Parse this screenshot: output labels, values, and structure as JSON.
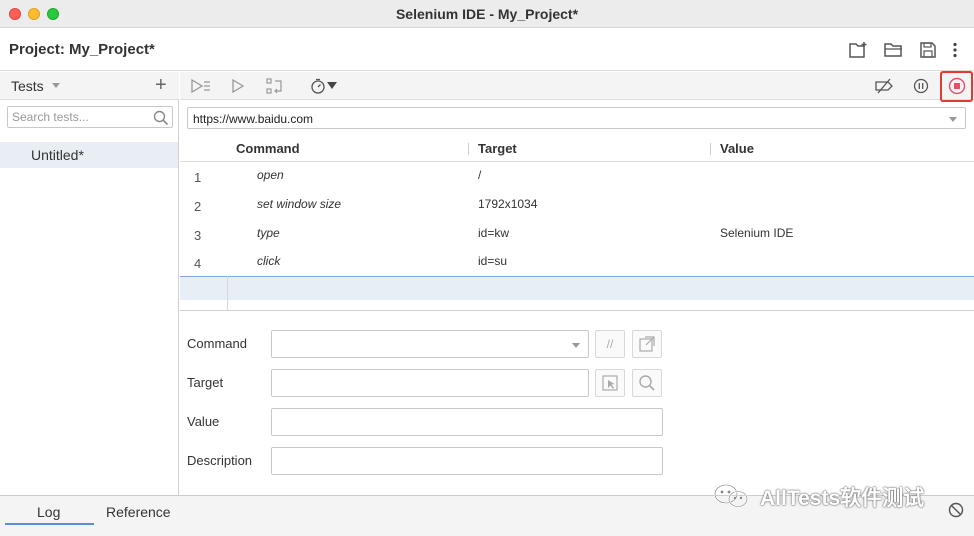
{
  "window": {
    "title": "Selenium IDE - My_Project*"
  },
  "project": {
    "label": "Project:",
    "name": "My_Project*"
  },
  "sidebar": {
    "title": "Tests",
    "search_placeholder": "Search tests...",
    "tests": [
      {
        "label": "Untitled*"
      }
    ]
  },
  "url": {
    "value": "https://www.baidu.com"
  },
  "grid": {
    "headers": {
      "command": "Command",
      "target": "Target",
      "value": "Value"
    },
    "rows": [
      {
        "num": "1",
        "command": "open",
        "target": "/",
        "value": ""
      },
      {
        "num": "2",
        "command": "set window size",
        "target": "1792x1034",
        "value": ""
      },
      {
        "num": "3",
        "command": "type",
        "target": "id=kw",
        "value": "Selenium IDE"
      },
      {
        "num": "4",
        "command": "click",
        "target": "id=su",
        "value": ""
      }
    ]
  },
  "editor": {
    "command_label": "Command",
    "target_label": "Target",
    "value_label": "Value",
    "description_label": "Description",
    "comment_button": "//"
  },
  "bottom": {
    "log_tab": "Log",
    "reference_tab": "Reference"
  },
  "watermark": {
    "text": "AllTests软件测试"
  },
  "colors": {
    "record_highlight": "#e23a2e",
    "record_icon": "#e8506a",
    "selected_row": "#e8eef5",
    "tab_underline": "#5a8fd6"
  }
}
